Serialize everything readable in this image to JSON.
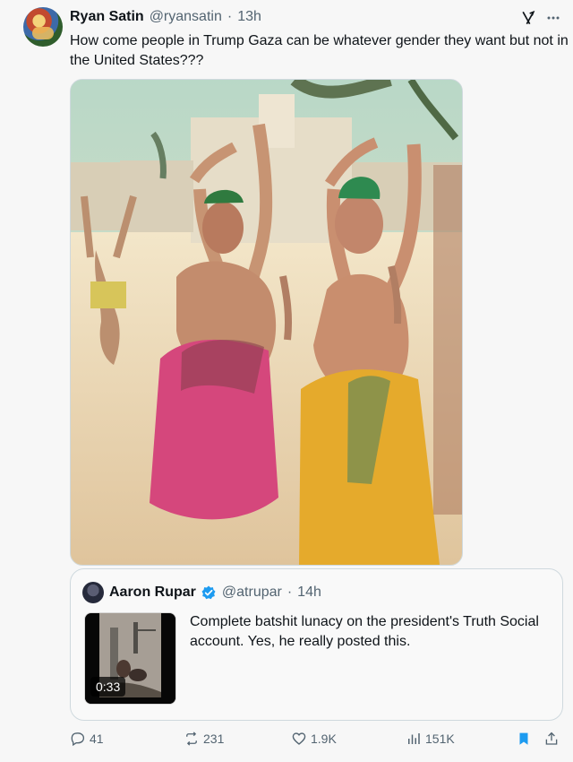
{
  "tweet": {
    "author_name": "Ryan Satin",
    "handle": "@ryansatin",
    "separator": "·",
    "time": "13h",
    "text": "How come people in Trump Gaza can be whatever gender they want but not in the United States???",
    "icons": [
      "grok-icon",
      "more-icon"
    ]
  },
  "quoted_tweet": {
    "author_name": "Aaron Rupar",
    "handle": "@atrupar",
    "separator": "·",
    "time": "14h",
    "text": "Complete batshit lunacy on the president's Truth Social account. Yes, he really posted this.",
    "video_duration": "0:33"
  },
  "actions": {
    "replies": "41",
    "reposts": "231",
    "likes": "1.9K",
    "views": "151K"
  },
  "colors": {
    "text": "#0f1419",
    "muted": "#536471",
    "verified": "#1d9bf0",
    "bookmark": "#1d9bf0",
    "border": "#cfd9de"
  }
}
